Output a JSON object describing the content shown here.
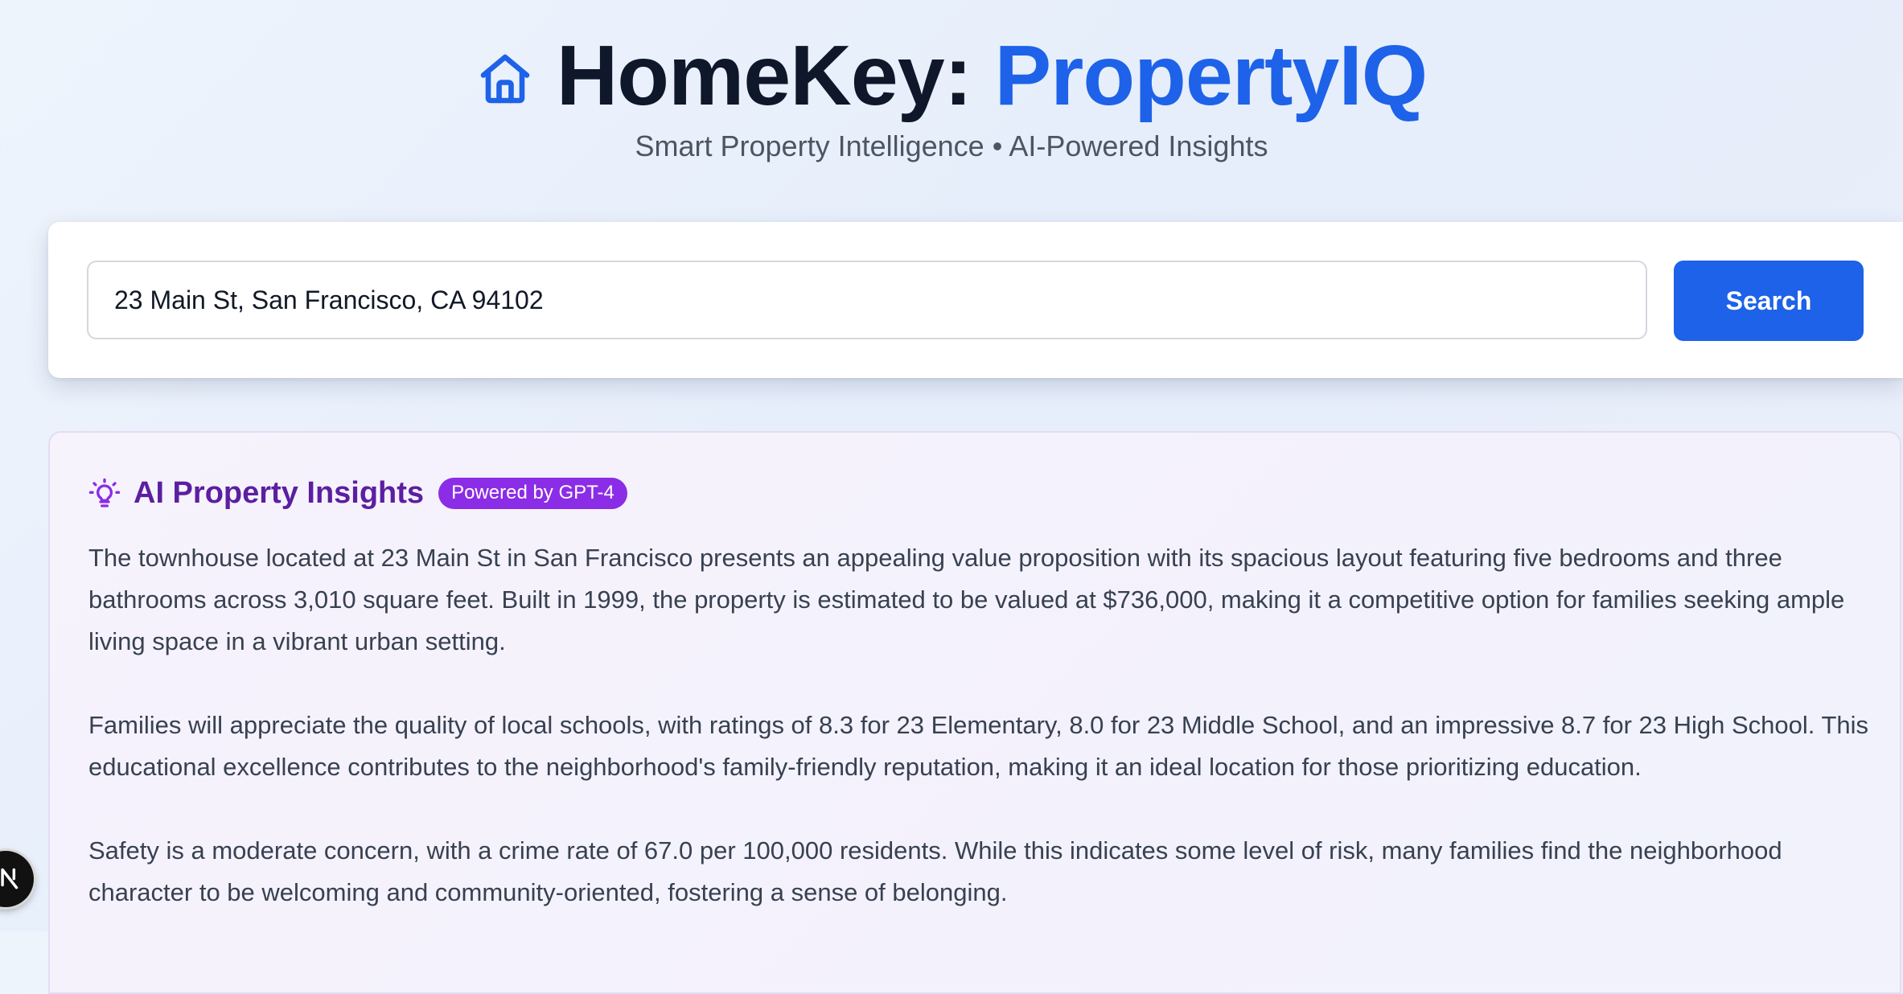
{
  "header": {
    "title_main": "HomeKey: ",
    "title_accent": "PropertyIQ",
    "subtitle": "Smart Property Intelligence • AI-Powered Insights",
    "icon": "home-icon"
  },
  "search": {
    "value": "23 Main St, San Francisco, CA 94102",
    "button_label": "Search"
  },
  "insights": {
    "icon": "lightbulb-icon",
    "title": "AI Property Insights",
    "badge": "Powered by GPT-4",
    "paragraphs": [
      "The townhouse located at 23 Main St in San Francisco presents an appealing value proposition with its spacious layout featuring five bedrooms and three bathrooms across 3,010 square feet. Built in 1999, the property is estimated to be valued at $736,000, making it a competitive option for families seeking ample living space in a vibrant urban setting.",
      "Families will appreciate the quality of local schools, with ratings of 8.3 for 23 Elementary, 8.0 for 23 Middle School, and an impressive 8.7 for 23 High School. This educational excellence contributes to the neighborhood's family-friendly reputation, making it an ideal location for those prioritizing education.",
      "Safety is a moderate concern, with a crime rate of 67.0 per 100,000 residents. While this indicates some level of risk, many families find the neighborhood character to be welcoming and community-oriented, fostering a sense of belonging."
    ]
  },
  "colors": {
    "brand_blue": "#1d62e8",
    "insights_purple": "#5b1fa0",
    "badge_purple": "#8b2ce6"
  },
  "dev_badge": {
    "icon": "nextjs-logo-icon"
  }
}
